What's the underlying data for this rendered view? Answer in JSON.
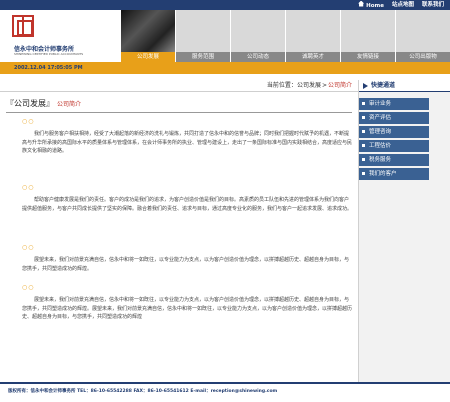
{
  "topnav": {
    "home": "Home",
    "contact": "站点地图",
    "about": "联系我们"
  },
  "header": {
    "company_name": "信永中和会计师事务所",
    "company_en": "SHINEWING CERTIFIED PUBLIC ACCOUNTANTS",
    "tabs": [
      {
        "label": "公司发展",
        "active": true
      },
      {
        "label": "服务范围"
      },
      {
        "label": "公司动态"
      },
      {
        "label": "诚聘英才"
      },
      {
        "label": "友情链接"
      },
      {
        "label": "公司出版物"
      }
    ],
    "date": "2002.12.04 17:05:05 PM"
  },
  "breadcrumb": {
    "prefix": "当前位置：",
    "section": "公司发展",
    "sep": ">",
    "current": "公司简介"
  },
  "main": {
    "title": "『公司发展』",
    "subtitle": "公司简介",
    "dots": "○○",
    "paragraphs": [
      "我们与服务客户相扶相持，经受了大潮起落的新经济的洗礼与锻炼，共同打造了信永中和的信誉与品牌；同时我们把握时代赋予的机遇，不断提高与升华所承接的高国际水平的质量体系与管理体系，在会计师事务所的执业、管理与建设上，走出了一条国际标准与国内实践相结合，高度适应与民族文化相融的道路。",
      "帮助客户健康发展是我们的责任。客户的成功是我们的追求，为客户创造价值是我们的目标。高素质的员工队伍和先进的管理体系为我们向客户提供超值服务，与客户共同成长提供了坚实的保障。融合着我们的责任、追求与目标，通过高度专业化的服务，我们与客户一起追求发展、追求成功。",
      "展望未来，我们对前景充满自信，信永中和将一如既往，以专业能力为支点，以为客户创造价值为理念，以拼搏超越历史、超越自身为目标，与您携手，共同塑造成功的辉煌。",
      "展望未来，我们对前景充满自信，信永中和将一如既往，以专业能力为支点，以为客户创造价值为理念，以拼搏超越历史、超越自身为目标，与您携手，共同塑造成功的辉煌。展望未来，我们对前景充满自信，信永中和将一如既往，以专业能力为支点，以为客户创造价值为理念，以拼搏超越历史、超越自身为目标，与您携手，共同塑造成功的辉煌"
    ]
  },
  "sidebar": {
    "heading": "快捷通道",
    "items": [
      {
        "label": "审计业务",
        "active": true
      },
      {
        "label": "资产评估"
      },
      {
        "label": "管理咨询"
      },
      {
        "label": "工程估价"
      },
      {
        "label": "税务服务"
      },
      {
        "label": "我们的客户"
      }
    ]
  },
  "footer": {
    "text": "版权所有：信永中和会计师事务所    TEL：86-10-65542288    FAX：86-10-65541612    E-mail：reception@shinewing.com"
  },
  "colors": {
    "navy": "#233e72",
    "accent": "#e8a019",
    "red": "#c0342b"
  }
}
